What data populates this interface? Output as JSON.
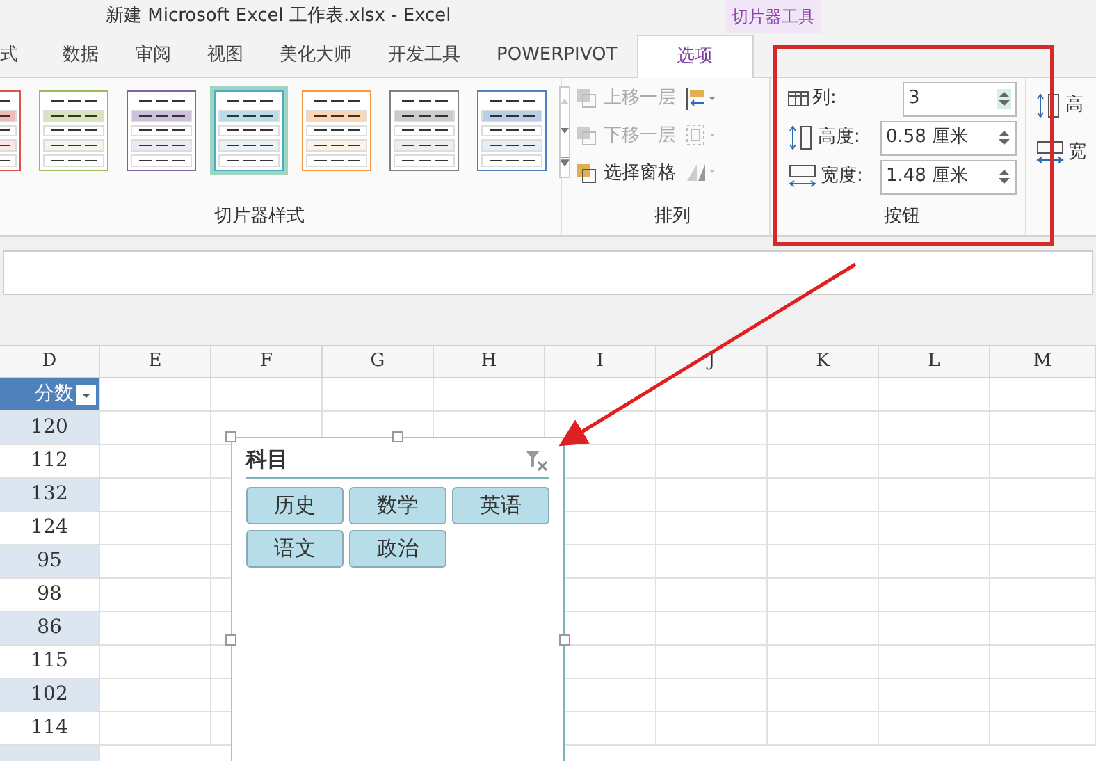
{
  "window": {
    "title": "新建 Microsoft Excel 工作表.xlsx - Excel",
    "context_label": "切片器工具"
  },
  "tabs": [
    {
      "label": "式",
      "selected": false
    },
    {
      "label": "数据",
      "selected": false
    },
    {
      "label": "审阅",
      "selected": false
    },
    {
      "label": "视图",
      "selected": false
    },
    {
      "label": "美化大师",
      "selected": false
    },
    {
      "label": "开发工具",
      "selected": false
    },
    {
      "label": "POWERPIVOT",
      "selected": false
    },
    {
      "label": "选项",
      "selected": true
    }
  ],
  "ribbon": {
    "styles_group": {
      "label": "切片器样式",
      "styles": [
        {
          "color": "#d9534f",
          "selected": false
        },
        {
          "color": "#9bbb59",
          "selected": false
        },
        {
          "color": "#8064a2",
          "selected": false
        },
        {
          "color": "#4bacc6",
          "selected": true
        },
        {
          "color": "#f79646",
          "selected": false
        },
        {
          "color": "#7f7f7f",
          "selected": false
        },
        {
          "color": "#4f81bd",
          "selected": false
        }
      ]
    },
    "arrange_group": {
      "label": "排列",
      "items": [
        {
          "label": "上移一层",
          "disabled": true
        },
        {
          "label": "下移一层",
          "disabled": true
        },
        {
          "label": "选择窗格",
          "disabled": false
        }
      ]
    },
    "buttons_group": {
      "label": "按钮",
      "fields": [
        {
          "label": "列:",
          "value": "3",
          "kind": "columns"
        },
        {
          "label": "高度:",
          "value": "0.58 厘米",
          "kind": "height"
        },
        {
          "label": "宽度:",
          "value": "1.48 厘米",
          "kind": "width"
        }
      ]
    },
    "size_group": {
      "items": [
        {
          "label": "高",
          "kind": "height"
        },
        {
          "label": "宽",
          "kind": "width"
        }
      ]
    }
  },
  "sheet": {
    "columns": [
      "D",
      "E",
      "F",
      "G",
      "H",
      "I",
      "J",
      "K",
      "L",
      "M"
    ],
    "header_cell": "分数",
    "values": [
      "120",
      "112",
      "132",
      "124",
      "95",
      "98",
      "86",
      "115",
      "102",
      "114"
    ]
  },
  "slicer": {
    "title": "科目",
    "items": [
      "历史",
      "数学",
      "英语",
      "语文",
      "政治"
    ]
  }
}
